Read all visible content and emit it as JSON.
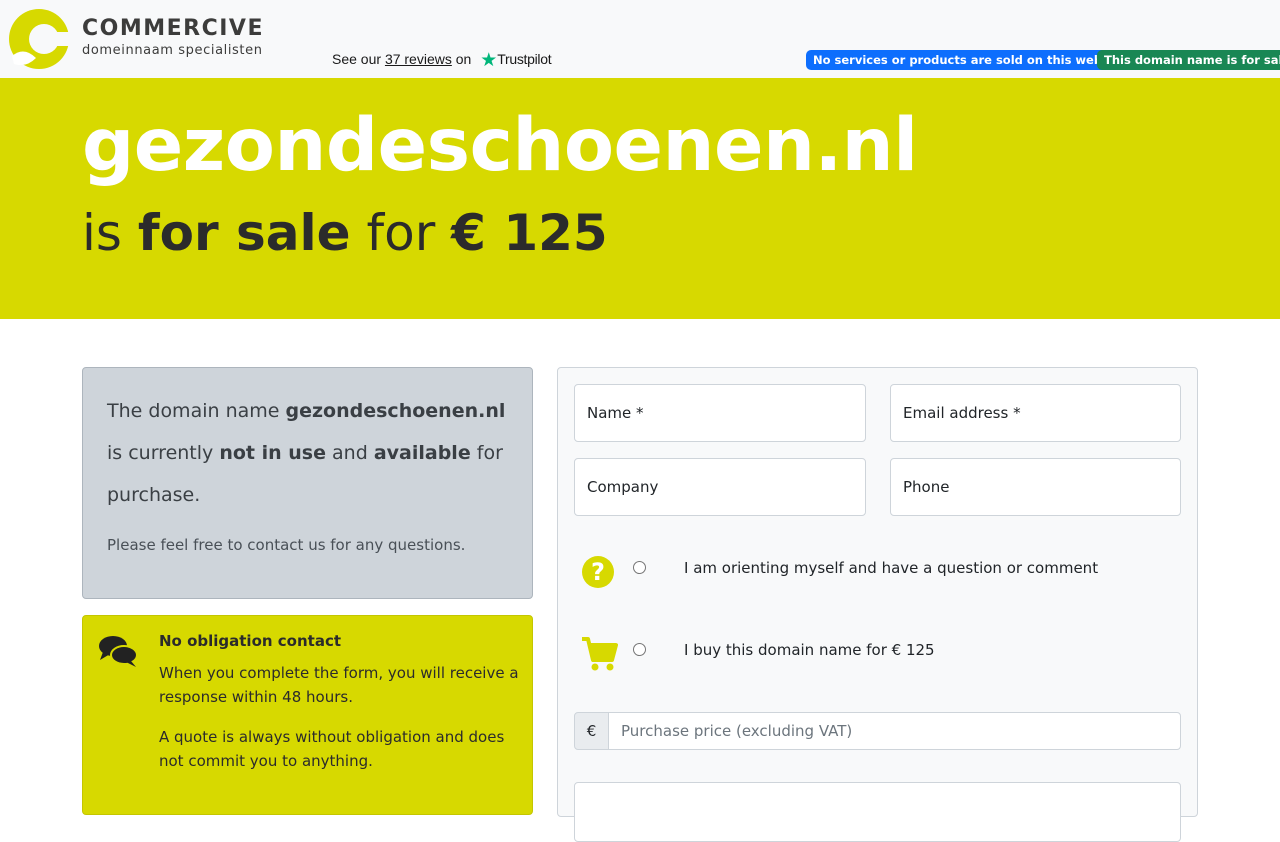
{
  "header": {
    "brand_name": "COMMERCIVE",
    "brand_tagline": "domeinnaam specialisten",
    "trustpilot_prefix": "See our",
    "trustpilot_reviews_link": "37 reviews",
    "trustpilot_on": "on",
    "trustpilot_name": "Trustpilot",
    "badge_notice": "No services or products are sold on this website.",
    "badge_forsale": "This domain name is for sale"
  },
  "hero": {
    "domain": "gezondeschoenen.nl",
    "is": "is",
    "for_sale": "for sale",
    "for": "for",
    "price": "€ 125"
  },
  "info": {
    "lead_1": "The domain name",
    "lead_domain": "gezondeschoenen.nl",
    "lead_2": "is currently",
    "not_in_use": "not in use",
    "and": "and",
    "available": "available",
    "lead_3": "for purchase.",
    "small": "Please feel free to contact us for any questions."
  },
  "contact": {
    "title": "No obligation contact",
    "p1": "When you complete the form, you will receive a response within 48 hours.",
    "p2": "A quote is always without obligation and does not commit you to anything."
  },
  "form": {
    "name_label": "Name *",
    "email_label": "Email address *",
    "company_label": "Company",
    "phone_label": "Phone",
    "option_question": "I am orienting myself and have a question or comment",
    "option_buy": "I buy this domain name for € 125",
    "currency_symbol": "€",
    "price_placeholder": "Purchase price (excluding VAT)"
  },
  "colors": {
    "brand_yellow": "#d7d900",
    "badge_blue": "#0d6efd",
    "badge_green": "#198754",
    "trustpilot_green": "#00b67a"
  }
}
